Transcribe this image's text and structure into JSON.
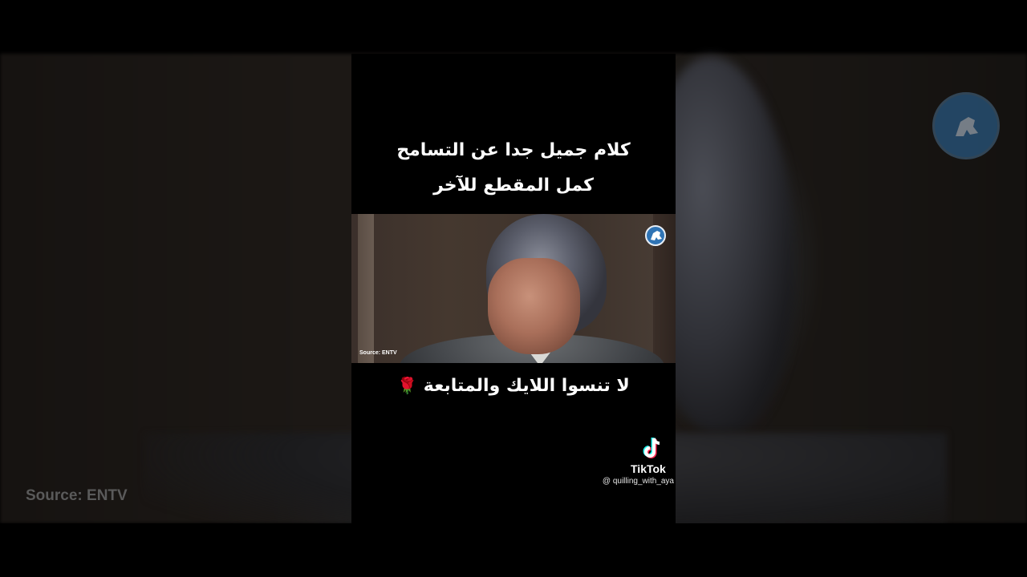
{
  "video": {
    "title_line_1": "كلام جميل جدا عن التسامح",
    "title_line_2": "كمل المقطع للآخر",
    "call_to_action": "لا تنسوا اللايك والمتابعة",
    "call_to_action_emoji": "🌹",
    "source_label": "Source: ENTV",
    "background_source_label": "Source: ENTV"
  },
  "watermark": {
    "brand": "TikTok",
    "username": "@ quilling_with_aya",
    "icon": "tiktok-note-icon"
  },
  "colors": {
    "background": "#000000",
    "text": "#ffffff",
    "channel_logo": "#2f74b5"
  }
}
